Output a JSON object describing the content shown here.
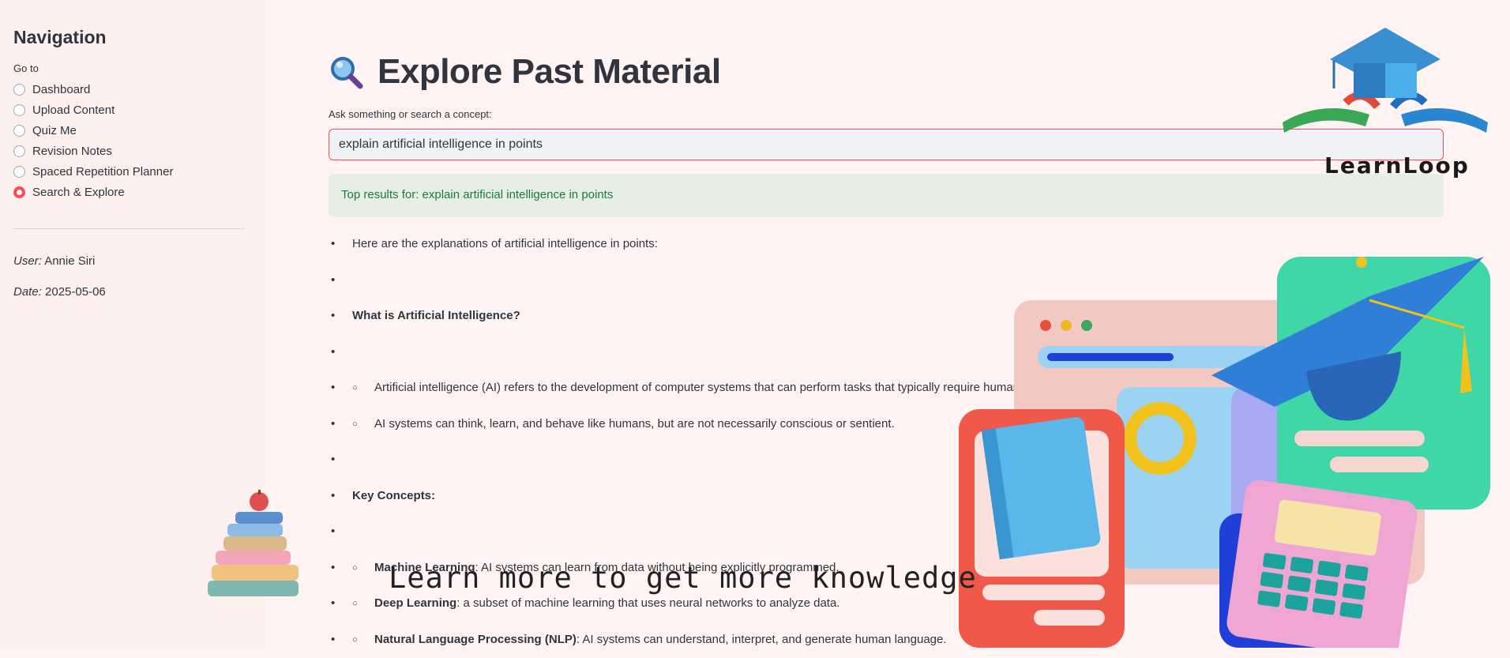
{
  "sidebar": {
    "title": "Navigation",
    "goto_label": "Go to",
    "items": [
      {
        "label": "Dashboard",
        "selected": false
      },
      {
        "label": "Upload Content",
        "selected": false
      },
      {
        "label": "Quiz Me",
        "selected": false
      },
      {
        "label": "Revision Notes",
        "selected": false
      },
      {
        "label": "Spaced Repetition Planner",
        "selected": false
      },
      {
        "label": "Search & Explore",
        "selected": true
      }
    ],
    "user_label": "User:",
    "user_value": "Annie Siri",
    "date_label": "Date:",
    "date_value": "2025-05-06"
  },
  "main": {
    "title": "Explore Past Material",
    "title_icon": "magnifying-glass-icon",
    "input_label": "Ask something or search a concept:",
    "input_value": "explain artificial intelligence in points",
    "results_header": "Top results for: explain artificial intelligence in points",
    "results": [
      {
        "type": "plain",
        "text": "Here are the explanations of artificial intelligence in points:"
      },
      {
        "type": "empty",
        "text": ""
      },
      {
        "type": "bold",
        "text": "What is Artificial Intelligence?"
      },
      {
        "type": "empty",
        "text": ""
      },
      {
        "type": "sub",
        "text": "Artificial intelligence (AI) refers to the development of computer systems that can perform tasks that typically require human intelligence."
      },
      {
        "type": "sub",
        "text": "AI systems can think, learn, and behave like humans, but are not necessarily conscious or sentient."
      },
      {
        "type": "empty",
        "text": ""
      },
      {
        "type": "bold",
        "text": "Key Concepts:"
      },
      {
        "type": "empty",
        "text": ""
      },
      {
        "type": "sub",
        "term": "Machine Learning",
        "text": ": AI systems can learn from data without being explicitly programmed."
      },
      {
        "type": "sub",
        "term": "Deep Learning",
        "text": ": a subset of machine learning that uses neural networks to analyze data."
      },
      {
        "type": "sub",
        "term": "Natural Language Processing (NLP)",
        "text": ": AI systems can understand, interpret, and generate human language."
      }
    ]
  },
  "branding": {
    "logo_text": "LearnLoop",
    "tagline": "Learn more to get more knowledge"
  },
  "colors": {
    "accent": "#ff4b4b",
    "success_bg": "#e7efe4",
    "success_text": "#1b7a3b",
    "background": "#fff4f3"
  }
}
